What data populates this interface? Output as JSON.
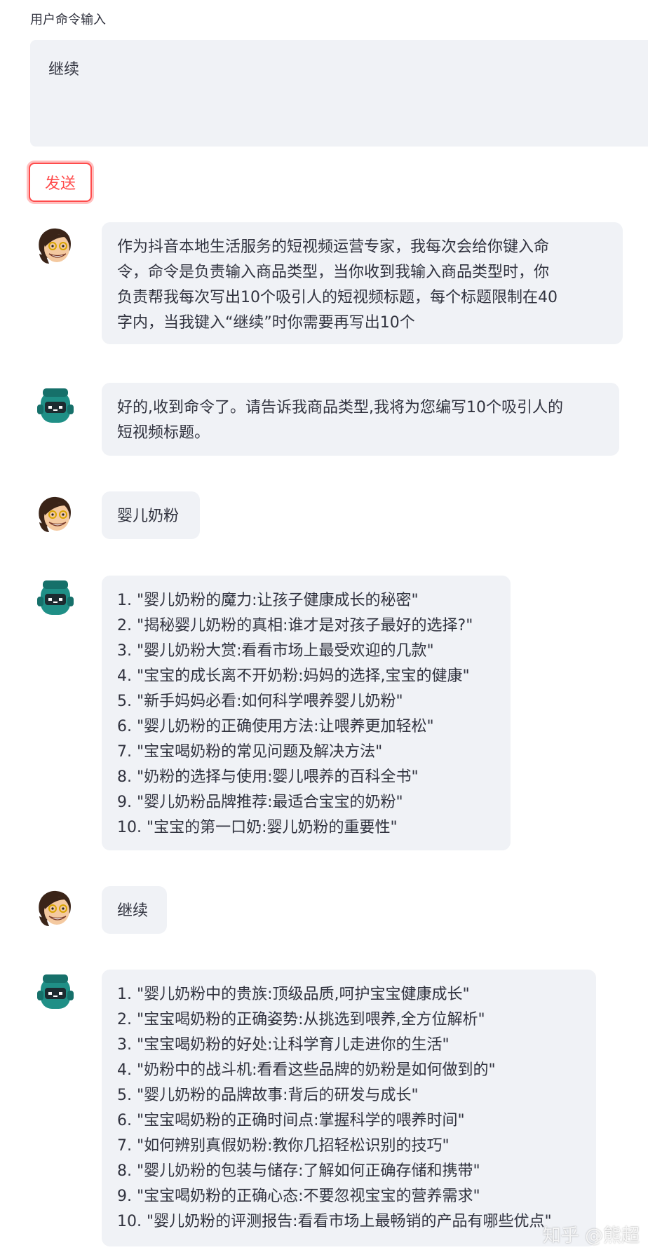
{
  "command_input": {
    "label": "用户命令输入",
    "value": "继续"
  },
  "send_button": {
    "label": "发送"
  },
  "colors": {
    "accent": "#ff4b4b",
    "bubble_bg": "#f0f2f6",
    "text": "#31333f",
    "robot_avatar": "#1f8f86"
  },
  "messages": [
    {
      "role": "user",
      "avatar": "user-avatar-icon",
      "lines": [
        "作为抖音本地生活服务的短视频运营专家，我每次会给你键入命",
        "令，命令是负责输入商品类型，当你收到我输入商品类型时，你",
        "负责帮我每次写出10个吸引人的短视频标题，每个标题限制在40",
        "字内，当我键入“继续”时你需要再写出10个"
      ]
    },
    {
      "role": "assistant",
      "avatar": "robot-avatar-icon",
      "lines": [
        "好的,收到命令了。请告诉我商品类型,我将为您编写10个吸引人的",
        "短视频标题。"
      ]
    },
    {
      "role": "user",
      "avatar": "user-avatar-icon",
      "lines": [
        "婴儿奶粉"
      ]
    },
    {
      "role": "assistant",
      "avatar": "robot-avatar-icon",
      "lines": [
        "1. \"婴儿奶粉的魔力:让孩子健康成长的秘密\"",
        "2. \"揭秘婴儿奶粉的真相:谁才是对孩子最好的选择?\"",
        "3. \"婴儿奶粉大赏:看看市场上最受欢迎的几款\"",
        "4. \"宝宝的成长离不开奶粉:妈妈的选择,宝宝的健康\"",
        "5. \"新手妈妈必看:如何科学喂养婴儿奶粉\"",
        "6. \"婴儿奶粉的正确使用方法:让喂养更加轻松\"",
        "7. \"宝宝喝奶粉的常见问题及解决方法\"",
        "8. \"奶粉的选择与使用:婴儿喂养的百科全书\"",
        "9. \"婴儿奶粉品牌推荐:最适合宝宝的奶粉\"",
        "10. \"宝宝的第一口奶:婴儿奶粉的重要性\""
      ]
    },
    {
      "role": "user",
      "avatar": "user-avatar-icon",
      "lines": [
        "继续"
      ]
    },
    {
      "role": "assistant",
      "avatar": "robot-avatar-icon",
      "lines": [
        "1. \"婴儿奶粉中的贵族:顶级品质,呵护宝宝健康成长\"",
        "2. \"宝宝喝奶粉的正确姿势:从挑选到喂养,全方位解析\"",
        "3. \"宝宝喝奶粉的好处:让科学育儿走进你的生活\"",
        "4. \"奶粉中的战斗机:看看这些品牌的奶粉是如何做到的\"",
        "5. \"婴儿奶粉的品牌故事:背后的研发与成长\"",
        "6. \"宝宝喝奶粉的正确时间点:掌握科学的喂养时间\"",
        "7. \"如何辨别真假奶粉:教你几招轻松识别的技巧\"",
        "8. \"婴儿奶粉的包装与储存:了解如何正确存储和携带\"",
        "9. \"宝宝喝奶粉的正确心态:不要忽视宝宝的营养需求\"",
        "10. \"婴儿奶粉的评测报告:看看市场上最畅销的产品有哪些优点\""
      ]
    }
  ],
  "watermark": "知乎 @熊超"
}
